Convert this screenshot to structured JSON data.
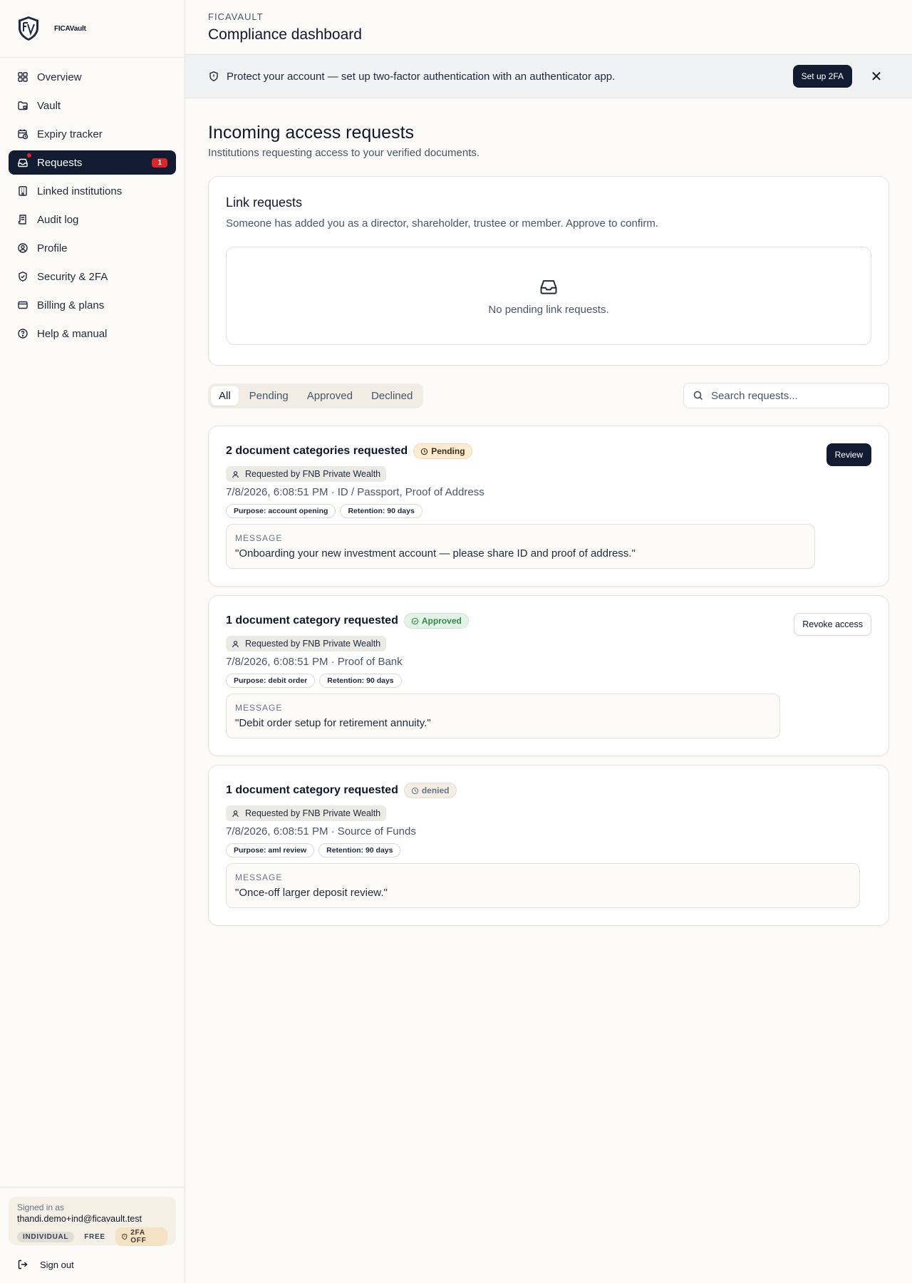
{
  "brand": {
    "name": "FICAVault"
  },
  "sidebar": {
    "items": [
      {
        "label": "Overview",
        "icon": "grid-icon"
      },
      {
        "label": "Vault",
        "icon": "folder-lock-icon"
      },
      {
        "label": "Expiry tracker",
        "icon": "calendar-clock-icon"
      },
      {
        "label": "Requests",
        "icon": "inbox-icon",
        "badge": "1",
        "active": true
      },
      {
        "label": "Linked institutions",
        "icon": "building-icon"
      },
      {
        "label": "Audit log",
        "icon": "log-icon"
      },
      {
        "label": "Profile",
        "icon": "user-circle-icon"
      },
      {
        "label": "Security & 2FA",
        "icon": "shield-check-icon"
      },
      {
        "label": "Billing & plans",
        "icon": "credit-card-icon"
      },
      {
        "label": "Help & manual",
        "icon": "help-circle-icon"
      }
    ],
    "user": {
      "signed_in_label": "Signed in as",
      "email": "thandi.demo+ind@ficavault.test",
      "account_type": "INDIVIDUAL",
      "plan": "FREE",
      "twofa_status": "2FA OFF"
    },
    "sign_out": "Sign out"
  },
  "header": {
    "eyebrow": "FICAVAULT",
    "title": "Compliance dashboard"
  },
  "banner": {
    "text": "Protect your account — set up two-factor authentication with an authenticator app.",
    "cta": "Set up 2FA",
    "close": "✕"
  },
  "page": {
    "title": "Incoming access requests",
    "subtitle": "Institutions requesting access to your verified documents."
  },
  "link_requests": {
    "title": "Link requests",
    "description": "Someone has added you as a director, shareholder, trustee or member. Approve to confirm.",
    "empty": "No pending link requests."
  },
  "filters": {
    "tabs": [
      "All",
      "Pending",
      "Approved",
      "Declined"
    ],
    "active": "All",
    "search_placeholder": "Search requests..."
  },
  "requests": [
    {
      "title": "2 document categories requested",
      "status": "Pending",
      "status_kind": "pending",
      "requester": "Requested by FNB Private Wealth",
      "meta": "7/8/2026, 6:08:51 PM · ID / Passport, Proof of Address",
      "purpose": "Purpose: account opening",
      "retention": "Retention: 90 days",
      "message_label": "MESSAGE",
      "message": "\"Onboarding your new investment account — please share ID and proof of address.\"",
      "action": "Review",
      "action_style": "dark"
    },
    {
      "title": "1 document category requested",
      "status": "Approved",
      "status_kind": "approved",
      "requester": "Requested by FNB Private Wealth",
      "meta": "7/8/2026, 6:08:51 PM · Proof of Bank",
      "purpose": "Purpose: debit order",
      "retention": "Retention: 90 days",
      "message_label": "MESSAGE",
      "message": "\"Debit order setup for retirement annuity.\"",
      "action": "Revoke access",
      "action_style": "outline"
    },
    {
      "title": "1 document category requested",
      "status": "denied",
      "status_kind": "denied",
      "requester": "Requested by FNB Private Wealth",
      "meta": "7/8/2026, 6:08:51 PM · Source of Funds",
      "purpose": "Purpose: aml review",
      "retention": "Retention: 90 days",
      "message_label": "MESSAGE",
      "message": "\"Once-off larger deposit review.\"",
      "action": "",
      "action_style": "none"
    }
  ],
  "colors": {
    "navy": "#111c33",
    "danger": "#dc2626",
    "pending_bg": "#fcecd3",
    "approved_fg": "#2f8a4a",
    "page_bg": "#fcfbf8"
  }
}
